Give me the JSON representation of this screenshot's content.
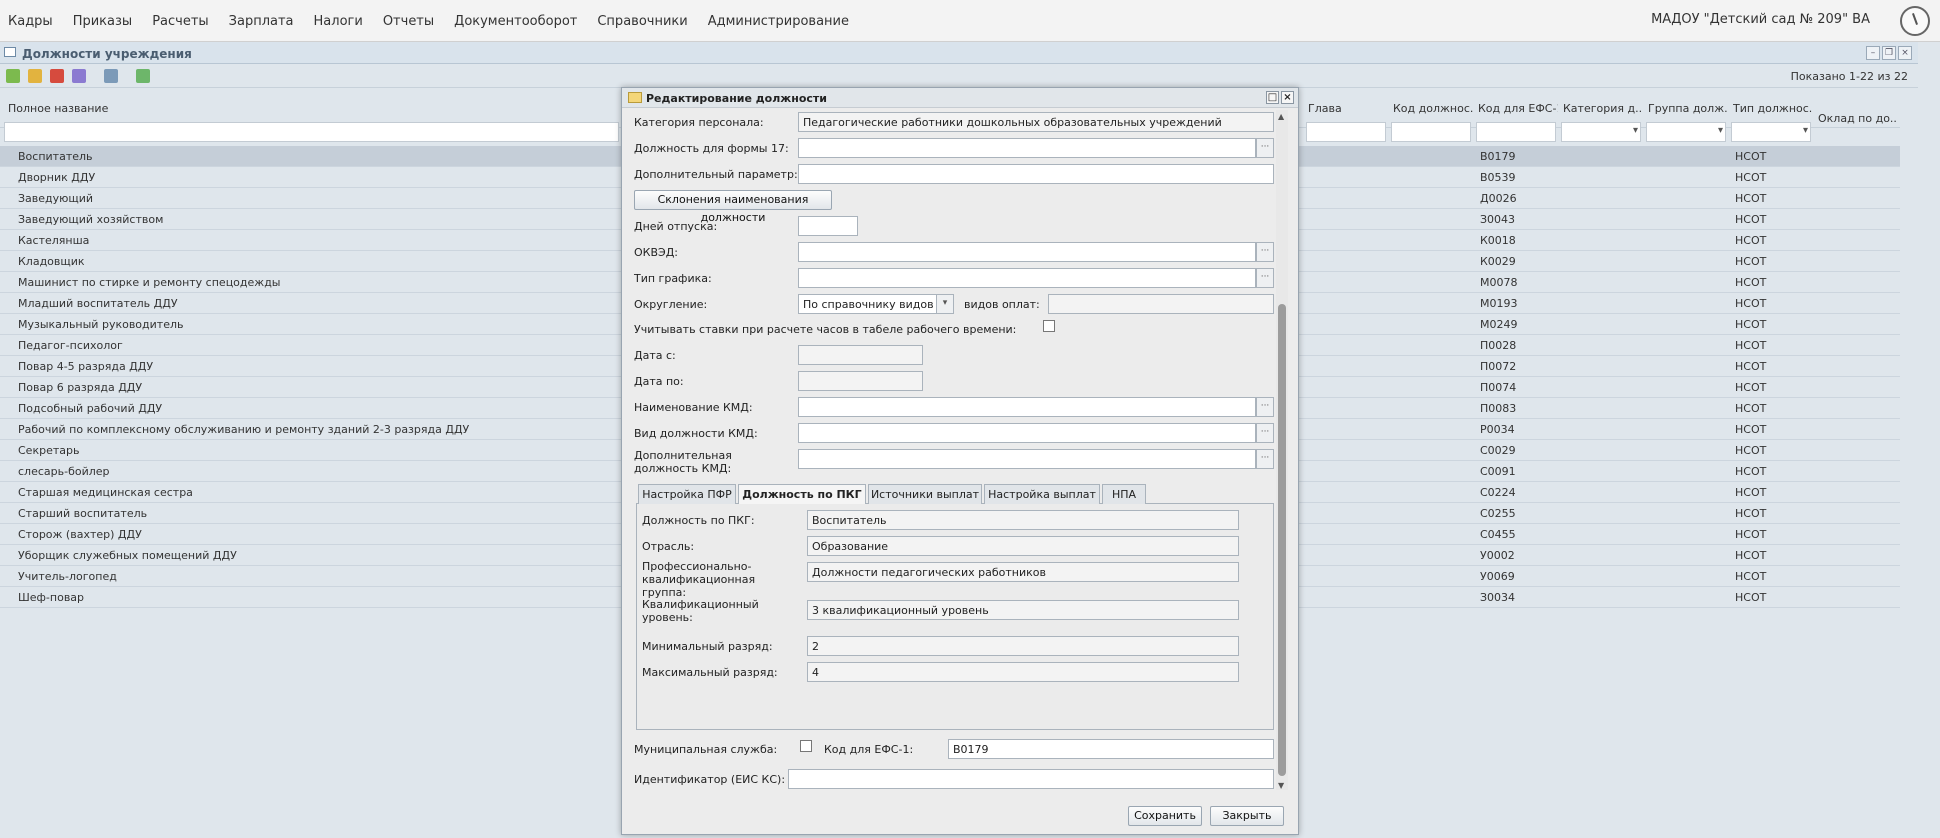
{
  "topbar": {
    "menu": [
      "Кадры",
      "Приказы",
      "Расчеты",
      "Зарплата",
      "Налоги",
      "Отчеты",
      "Документооборот",
      "Справочники",
      "Администрирование"
    ],
    "org": "МАДОУ \"Детский сад № 209\" ВА"
  },
  "gridwin": {
    "title": "Должности учреждения",
    "shown": "Показано 1-22 из 22",
    "columns": {
      "full_name": "Полное название",
      "head": "Глава",
      "pos_code": "Код должнос...",
      "efs_code": "Код для ЕФС-1",
      "category": "Категория д...",
      "group": "Группа долж...",
      "type": "Тип должнос...",
      "salary": "Оклад по до..."
    },
    "rows": [
      {
        "name": "Воспитатель",
        "efs": "В0179",
        "type": "НСОТ"
      },
      {
        "name": "Дворник ДДУ",
        "efs": "В0539",
        "type": "НСОТ"
      },
      {
        "name": "Заведующий",
        "efs": "Д0026",
        "type": "НСОТ"
      },
      {
        "name": "Заведующий хозяйством",
        "efs": "З0043",
        "type": "НСОТ"
      },
      {
        "name": "Кастелянша",
        "efs": "К0018",
        "type": "НСОТ"
      },
      {
        "name": "Кладовщик",
        "efs": "К0029",
        "type": "НСОТ"
      },
      {
        "name": "Машинист по стирке и ремонту спецодежды",
        "efs": "М0078",
        "type": "НСОТ"
      },
      {
        "name": "Младший воспитатель ДДУ",
        "efs": "М0193",
        "type": "НСОТ"
      },
      {
        "name": "Музыкальный руководитель",
        "efs": "М0249",
        "type": "НСОТ"
      },
      {
        "name": "Педагог-психолог",
        "efs": "П0028",
        "type": "НСОТ"
      },
      {
        "name": "Повар 4-5 разряда ДДУ",
        "efs": "П0072",
        "type": "НСОТ"
      },
      {
        "name": "Повар 6 разряда ДДУ",
        "efs": "П0074",
        "type": "НСОТ"
      },
      {
        "name": "Подсобный рабочий ДДУ",
        "efs": "П0083",
        "type": "НСОТ"
      },
      {
        "name": "Рабочий по комплексному обслуживанию и ремонту зданий 2-3 разряда ДДУ",
        "efs": "Р0034",
        "type": "НСОТ"
      },
      {
        "name": "Секретарь",
        "efs": "С0029",
        "type": "НСОТ"
      },
      {
        "name": "слесарь-бойлер",
        "efs": "С0091",
        "type": "НСОТ"
      },
      {
        "name": "Старшая медицинская сестра",
        "efs": "С0224",
        "type": "НСОТ"
      },
      {
        "name": "Старший воспитатель",
        "efs": "С0255",
        "type": "НСОТ"
      },
      {
        "name": "Сторож (вахтер) ДДУ",
        "efs": "С0455",
        "type": "НСОТ"
      },
      {
        "name": "Уборщик служебных помещений ДДУ",
        "efs": "У0002",
        "type": "НСОТ"
      },
      {
        "name": "Учитель-логопед",
        "efs": "У0069",
        "type": "НСОТ"
      },
      {
        "name": "Шеф-повар",
        "efs": "З0034",
        "type": "НСОТ"
      }
    ]
  },
  "dialog": {
    "title": "Редактирование должности",
    "labels": {
      "category": "Категория персонала:",
      "form17": "Должность для формы 17:",
      "extra": "Дополнительный параметр:",
      "decl": "Склонения наименования должности",
      "vacation": "Дней отпуска:",
      "okved": "ОКВЭД:",
      "schedule": "Тип графика:",
      "rounding": "Округление:",
      "pay_types": "видов оплат:",
      "rates": "Учитывать ставки при расчете часов в табеле рабочего времени:",
      "date_from": "Дата с:",
      "date_to": "Дата по:",
      "kmd_name": "Наименование КМД:",
      "kmd_kind": "Вид должности КМД:",
      "kmd_extra": "Дополнительная должность КМД:",
      "municipal": "Муниципальная служба:",
      "efs": "Код для ЕФС-1:",
      "eis": "Идентификатор (ЕИС КС):"
    },
    "values": {
      "category": "Педагогические работники дошкольных образовательных учреждений",
      "rounding": "По справочнику видов оплат",
      "efs": "В0179"
    },
    "tabs": [
      "Настройка ПФР",
      "Должность по ПКГ",
      "Источники выплат",
      "Настройка выплат",
      "НПА"
    ],
    "pkg": {
      "labels": {
        "pos": "Должность по ПКГ:",
        "branch": "Отрасль:",
        "group": "Профессионально-квалификационная группа:",
        "level": "Квалификационный уровень:",
        "min": "Минимальный разряд:",
        "max": "Максимальный разряд:"
      },
      "values": {
        "pos": "Воспитатель",
        "branch": "Образование",
        "group": "Должности педагогических работников",
        "level": "3 квалификационный уровень",
        "min": "2",
        "max": "4"
      }
    },
    "buttons": {
      "save": "Сохранить",
      "close": "Закрыть"
    }
  }
}
